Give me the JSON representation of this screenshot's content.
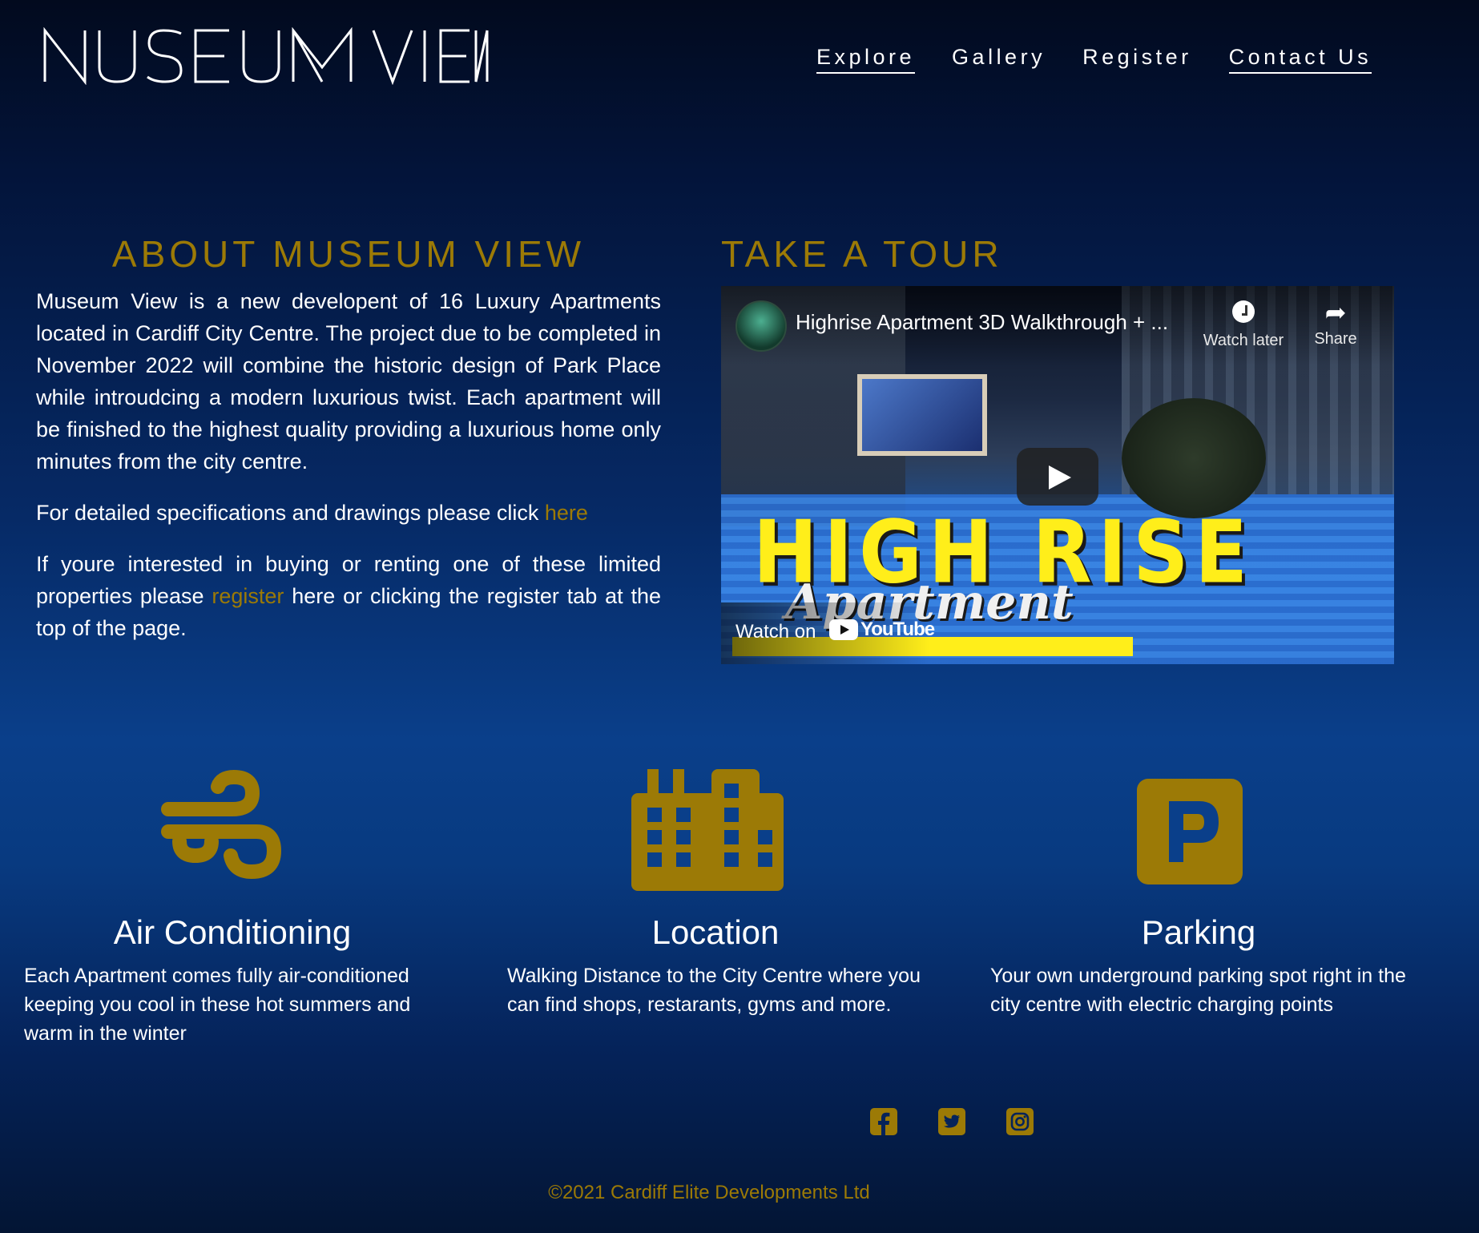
{
  "header": {
    "logo_text": "MUSEUM VIEW",
    "nav": [
      {
        "label": "Explore"
      },
      {
        "label": "Gallery"
      },
      {
        "label": "Register"
      },
      {
        "label": "Contact Us"
      }
    ]
  },
  "about": {
    "heading": "ABOUT MUSEUM VIEW",
    "paragraph1": "Museum View is a new developent of 16 Luxury Apartments located in Cardiff City Centre. The project due to be completed in November 2022 will combine the historic design of Park Place while introudcing a modern luxurious twist. Each apartment will be finished to the highest quality providing a luxurious home only minutes from the city centre.",
    "paragraph2_prefix": "For detailed specifications and drawings please click ",
    "paragraph2_link": "here",
    "paragraph3_prefix": "If youre interested in buying or renting one of these limited properties please ",
    "paragraph3_link": "register",
    "paragraph3_suffix": " here or clicking the register tab at the top of the page."
  },
  "tour": {
    "heading": "TAKE A TOUR",
    "video": {
      "title": "Highrise Apartment 3D Walkthrough + ...",
      "watch_later": "Watch later",
      "share": "Share",
      "watch_on": "Watch on",
      "youtube": "YouTube",
      "thumbnail_text_1": "HIGH RISE",
      "thumbnail_text_2": "Apartment"
    }
  },
  "features": [
    {
      "icon": "wind-icon",
      "title": "Air Conditioning",
      "description": "Each Apartment comes fully air-conditioned keeping you cool in these hot summers and warm in the winter"
    },
    {
      "icon": "city-buildings-icon",
      "title": "Location",
      "description": "Walking Distance to the City Centre where you can find shops, restarants, gyms and more."
    },
    {
      "icon": "parking-icon",
      "title": "Parking",
      "description": "Your own underground parking spot right in the city centre with electric charging points"
    }
  ],
  "footer": {
    "social": [
      "facebook-icon",
      "twitter-icon",
      "instagram-icon"
    ],
    "copyright": "©2021 Cardiff Elite Developments Ltd"
  },
  "colors": {
    "accent_gold": "#9c7a06",
    "text": "#ffffff",
    "background_top": "#020a1e",
    "background_mid": "#0a3f8a"
  }
}
